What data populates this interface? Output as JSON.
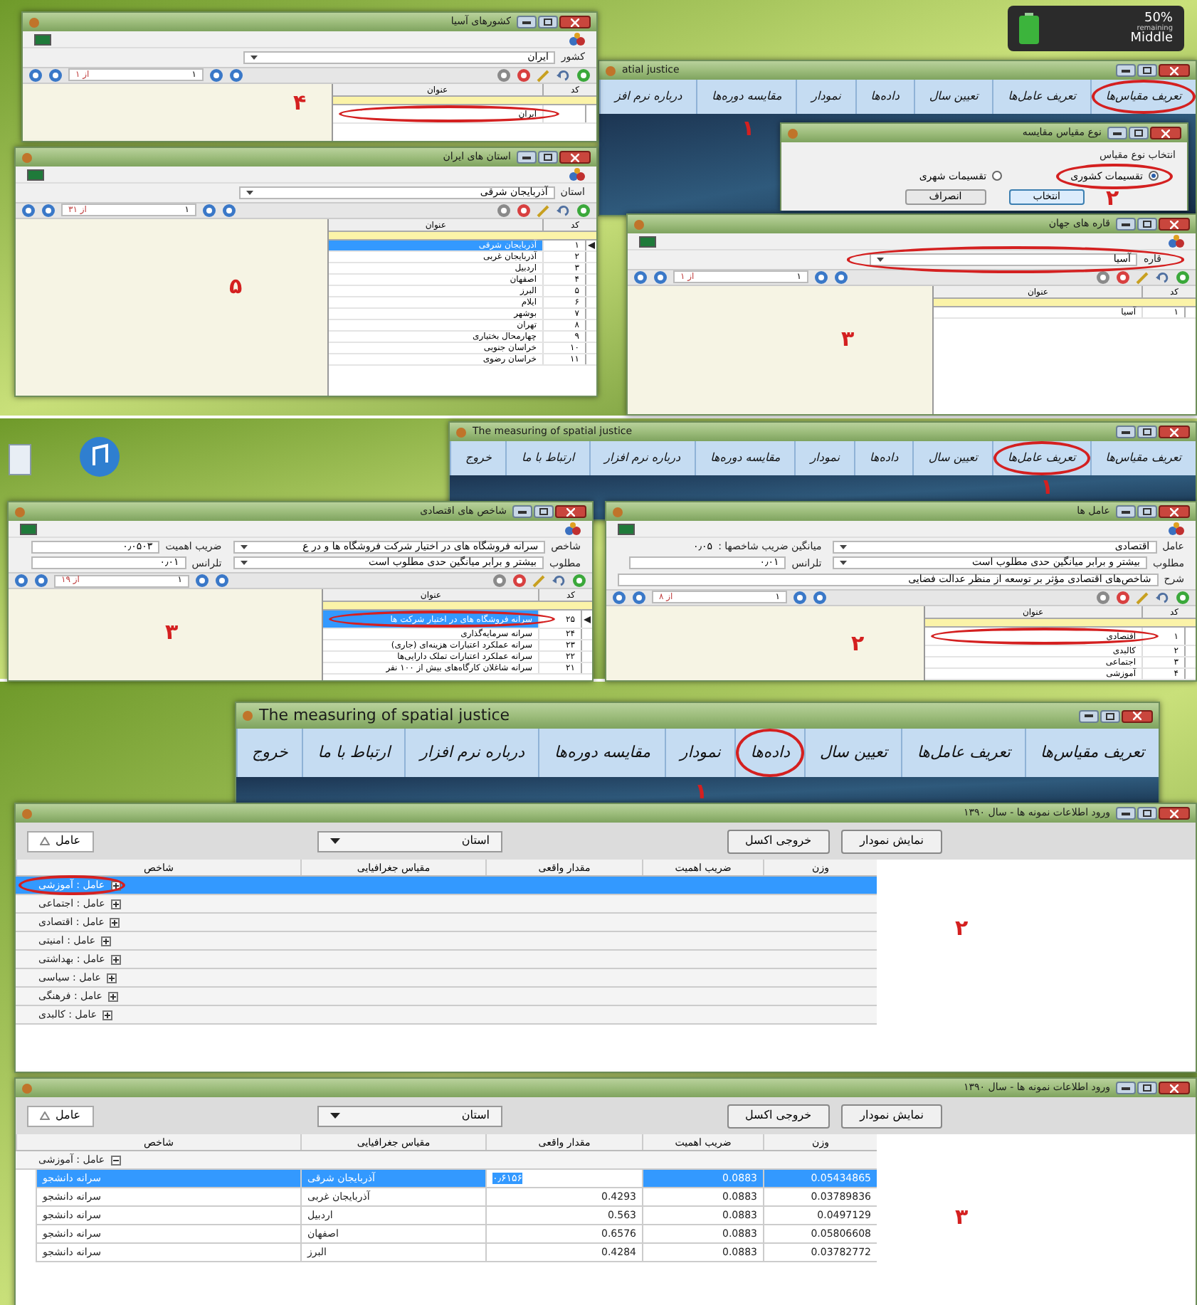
{
  "screens": [
    {
      "windows": [
        {
          "kind": "lookup",
          "title": "کشورهای آسیا",
          "annotation": "۴",
          "fields": [
            {
              "kind": "combo",
              "label": "کشور",
              "value": "ایران"
            }
          ],
          "pager": {
            "total": "از ۱",
            "current": "۱"
          },
          "columns": [
            "کد",
            "عنوان"
          ],
          "rows": [
            {
              "code": "",
              "title": "ایران",
              "selected": false,
              "circled": true
            }
          ]
        },
        {
          "kind": "lookup",
          "title": "استان های ایران",
          "annotation": "۵",
          "fields": [
            {
              "kind": "combo",
              "label": "استان",
              "value": "آذربایجان شرقی"
            }
          ],
          "pager": {
            "total": "از ۳۱",
            "current": "۱"
          },
          "columns": [
            "کد",
            "عنوان"
          ],
          "rows": [
            {
              "code": "۱",
              "title": "آذربایجان شرقی",
              "selected": true,
              "circled": false
            },
            {
              "code": "۲",
              "title": "آذربایجان غربی",
              "selected": false,
              "circled": false
            },
            {
              "code": "۳",
              "title": "اردبیل",
              "selected": false,
              "circled": false
            },
            {
              "code": "۴",
              "title": "اصفهان",
              "selected": false,
              "circled": false
            },
            {
              "code": "۵",
              "title": "البرز",
              "selected": false,
              "circled": false
            },
            {
              "code": "۶",
              "title": "ایلام",
              "selected": false,
              "circled": false
            },
            {
              "code": "۷",
              "title": "بوشهر",
              "selected": false,
              "circled": false
            },
            {
              "code": "۸",
              "title": "تهران",
              "selected": false,
              "circled": false
            },
            {
              "code": "۹",
              "title": "چهارمحال بختیاری",
              "selected": false,
              "circled": false
            },
            {
              "code": "۱۰",
              "title": "خراسان جنوبی",
              "selected": false,
              "circled": false
            },
            {
              "code": "۱۱",
              "title": "خراسان رضوی",
              "selected": false,
              "circled": false
            }
          ]
        },
        {
          "kind": "gadget",
          "percent": "50%",
          "caption": "remaining",
          "mode": "Middle"
        },
        {
          "kind": "main",
          "title": "atial justice",
          "annotation": "۱",
          "menu": [
            {
              "label": "تعریف مقیاس‌ها",
              "circled": true
            },
            {
              "label": "تعریف عامل‌ها",
              "circled": false
            },
            {
              "label": "تعیین سال",
              "circled": false
            },
            {
              "label": "داده‌ها",
              "circled": false
            },
            {
              "label": "نمودار",
              "circled": false
            },
            {
              "label": "مقایسه دوره‌ها",
              "circled": false
            },
            {
              "label": "درباره نرم افز",
              "circled": false
            }
          ]
        },
        {
          "kind": "dialog",
          "title": "نوع مقیاس مقایسه",
          "annotation": "۲",
          "group_label": "انتخاب نوع مقیاس",
          "options": [
            {
              "label": "تقسیمات کشوری",
              "selected": true,
              "circled": true
            },
            {
              "label": "تقسیمات شهری",
              "selected": false,
              "circled": false
            }
          ],
          "buttons": [
            "انتخاب",
            "انصراف"
          ]
        },
        {
          "kind": "lookup",
          "title": "قاره های جهان",
          "annotation": "۳",
          "fields": [
            {
              "kind": "combo",
              "label": "قاره",
              "value": "آسیا",
              "circled": true
            }
          ],
          "pager": {
            "total": "از ۱",
            "current": "۱"
          },
          "columns": [
            "کد",
            "عنوان"
          ],
          "rows": [
            {
              "code": "۱",
              "title": "آسیا",
              "selected": false,
              "circled": false
            }
          ]
        }
      ]
    },
    {
      "windows": [
        {
          "kind": "main",
          "title": "The measuring of spatial justice",
          "annotation": "۱",
          "menu": [
            {
              "label": "تعریف مقیاس‌ها",
              "circled": false
            },
            {
              "label": "تعریف عامل‌ها",
              "circled": true
            },
            {
              "label": "تعیین سال",
              "circled": false
            },
            {
              "label": "داده‌ها",
              "circled": false
            },
            {
              "label": "نمودار",
              "circled": false
            },
            {
              "label": "مقایسه دوره‌ها",
              "circled": false
            },
            {
              "label": "درباره نرم افزار",
              "circled": false
            },
            {
              "label": "ارتباط با ما",
              "circled": false
            },
            {
              "label": "خروج",
              "circled": false
            }
          ]
        },
        {
          "kind": "lookup",
          "title": "عامل ها",
          "annotation": "۲",
          "fields": [
            {
              "kind": "combo",
              "label": "عامل",
              "value": "اقتصادی"
            },
            {
              "kind": "readout",
              "label": "میانگین ضریب شاخصها :",
              "value": "۰٫۰۵"
            },
            {
              "kind": "combo",
              "label": "مطلوب",
              "value": "بیشتر و برابر میانگین حدی مطلوب است"
            },
            {
              "kind": "number",
              "label": "تلرانس",
              "value": "۰٫۰۱"
            },
            {
              "kind": "memo",
              "label": "شرح",
              "value": "شاخص‌های اقتصادی مؤثر بر توسعه از منظر عدالت فضایی"
            }
          ],
          "pager": {
            "total": "از ۸",
            "current": "۱"
          },
          "columns": [
            "کد",
            "عنوان"
          ],
          "rows": [
            {
              "code": "۱",
              "title": "اقتصادی",
              "selected": false,
              "circled": true
            },
            {
              "code": "۲",
              "title": "کالبدی",
              "selected": false,
              "circled": false
            },
            {
              "code": "۳",
              "title": "اجتماعی",
              "selected": false,
              "circled": false
            },
            {
              "code": "۴",
              "title": "آموزشی",
              "selected": false,
              "circled": false
            }
          ]
        },
        {
          "kind": "lookup",
          "title": "شاخص های اقتصادی",
          "annotation": "۳",
          "fields": [
            {
              "kind": "combo",
              "label": "شاخص",
              "value": "سرانه فروشگاه های در اختیار شرکت فروشگاه ها و در ع"
            },
            {
              "kind": "number",
              "label": "ضریب اهمیت",
              "value": "۰٫۰۵۰۳"
            },
            {
              "kind": "combo",
              "label": "مطلوب",
              "value": "بیشتر و برابر میانگین حدی مطلوب است"
            },
            {
              "kind": "number",
              "label": "تلرانس",
              "value": "۰٫۰۱"
            }
          ],
          "pager": {
            "total": "از ۱۹",
            "current": "۱"
          },
          "columns": [
            "کد",
            "عنوان"
          ],
          "rows": [
            {
              "code": "۲۵",
              "title": "سرانه فروشگاه های در اختیار شرکت ها",
              "selected": true,
              "circled": true
            },
            {
              "code": "۲۴",
              "title": "سرانه سرمایه‌گذاری",
              "selected": false,
              "circled": false
            },
            {
              "code": "۲۳",
              "title": "سرانه عملکرد اعتبارات هزینه‌ای (جاری)",
              "selected": false,
              "circled": false
            },
            {
              "code": "۲۲",
              "title": "سرانه عملکرد اعتبارات تملک دارایی‌ها",
              "selected": false,
              "circled": false
            },
            {
              "code": "۲۱",
              "title": "سرانه شاغلان کارگاه‌های بیش از ۱۰۰ نفر",
              "selected": false,
              "circled": false
            }
          ]
        }
      ]
    },
    {
      "windows": [
        {
          "kind": "main",
          "title": "The measuring of spatial justice",
          "annotation": "۱",
          "menu": [
            {
              "label": "تعریف مقیاس‌ها",
              "circled": false
            },
            {
              "label": "تعریف عامل‌ها",
              "circled": false
            },
            {
              "label": "تعیین سال",
              "circled": false
            },
            {
              "label": "داده‌ها",
              "circled": true
            },
            {
              "label": "نمودار",
              "circled": false
            },
            {
              "label": "مقایسه دوره‌ها",
              "circled": false
            },
            {
              "label": "درباره نرم افزار",
              "circled": false
            },
            {
              "label": "ارتباط با ما",
              "circled": false
            },
            {
              "label": "خروج",
              "circled": false
            }
          ]
        },
        {
          "kind": "data_entry",
          "title": "ورود اطلاعات نمونه ها - سال ۱۳۹۰",
          "annotation": "۲",
          "group_chip": "عامل",
          "dropdown": "استان",
          "buttons": [
            "نمایش نمودار",
            "خروجی اکسل"
          ],
          "columns": [
            "وزن",
            "ضریب اهمیت",
            "مقدار واقعی",
            "مقیاس جغرافیایی",
            "شاخص"
          ],
          "groups": [
            {
              "label": "عامل : آموزشی",
              "expanded": false,
              "selected": true,
              "circled": true
            },
            {
              "label": "عامل : اجتماعی",
              "expanded": false,
              "selected": false,
              "circled": false
            },
            {
              "label": "عامل : اقتصادی",
              "expanded": false,
              "selected": false,
              "circled": false
            },
            {
              "label": "عامل : امنیتی",
              "expanded": false,
              "selected": false,
              "circled": false
            },
            {
              "label": "عامل : بهداشتی",
              "expanded": false,
              "selected": false,
              "circled": false
            },
            {
              "label": "عامل : سیاسی",
              "expanded": false,
              "selected": false,
              "circled": false
            },
            {
              "label": "عامل : فرهنگی",
              "expanded": false,
              "selected": false,
              "circled": false
            },
            {
              "label": "عامل : کالبدی",
              "expanded": false,
              "selected": false,
              "circled": false
            }
          ]
        },
        {
          "kind": "data_entry",
          "title": "ورود اطلاعات نمونه ها - سال ۱۳۹۰",
          "annotation": "۳",
          "group_chip": "عامل",
          "dropdown": "استان",
          "buttons": [
            "نمایش نمودار",
            "خروجی اکسل"
          ],
          "columns": [
            "وزن",
            "ضریب اهمیت",
            "مقدار واقعی",
            "مقیاس جغرافیایی",
            "شاخص"
          ],
          "groups": [
            {
              "label": "عامل : آموزشی",
              "expanded": true,
              "selected": false,
              "circled": false,
              "rows": [
                {
                  "cells": [
                    "0.05434865",
                    "0.0883",
                    "۰٫۶۱۵۶",
                    "آذربایجان شرقی",
                    "سرانه دانشجو"
                  ],
                  "selected": true,
                  "editing": true
                },
                {
                  "cells": [
                    "0.03789836",
                    "0.0883",
                    "0.4293",
                    "آذربایجان غربی",
                    "سرانه دانشجو"
                  ],
                  "selected": false,
                  "editing": false
                },
                {
                  "cells": [
                    "0.0497129",
                    "0.0883",
                    "0.563",
                    "اردبیل",
                    "سرانه دانشجو"
                  ],
                  "selected": false,
                  "editing": false
                },
                {
                  "cells": [
                    "0.05806608",
                    "0.0883",
                    "0.6576",
                    "اصفهان",
                    "سرانه دانشجو"
                  ],
                  "selected": false,
                  "editing": false
                },
                {
                  "cells": [
                    "0.03782772",
                    "0.0883",
                    "0.4284",
                    "البرز",
                    "سرانه دانشجو"
                  ],
                  "selected": false,
                  "editing": false
                }
              ]
            }
          ]
        }
      ]
    }
  ]
}
